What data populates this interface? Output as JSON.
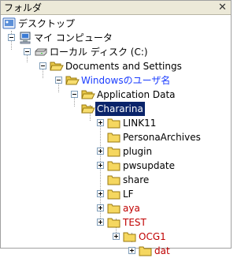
{
  "panel": {
    "title": "フォルダ",
    "close_icon": "close-icon"
  },
  "tree": {
    "desktop": "デスクトップ",
    "my_computer": "マイ コンピュータ",
    "local_disk": "ローカル ディスク (C:)",
    "documents_and_settings": "Documents and Settings",
    "windows_user": "Windowsのユーザ名",
    "application_data": "Application Data",
    "chararina": "Chararina",
    "link11": "LINK11",
    "persona_archives": "PersonaArchives",
    "plugin": "plugin",
    "pwsupdate": "pwsupdate",
    "share": "share",
    "lf": "LF",
    "aya": "aya",
    "test": "TEST",
    "ocg1": "OCG1",
    "dat": "dat"
  },
  "colors": {
    "highlight_red": "#c00000",
    "highlight_blue": "#1a3cff",
    "selection": "#0a246a"
  }
}
